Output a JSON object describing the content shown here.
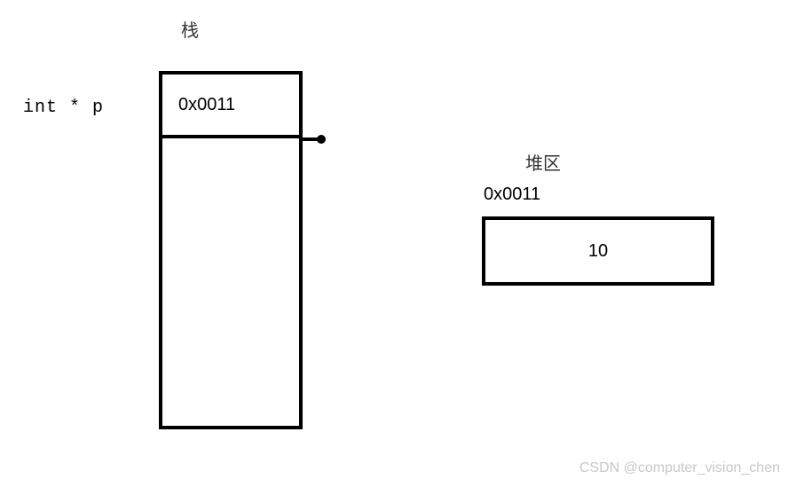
{
  "stack": {
    "title": "栈",
    "pointer_label": "int * p",
    "cell_value": "0x0011"
  },
  "heap": {
    "title": "堆区",
    "address": "0x0011",
    "value": "10"
  },
  "watermark": "CSDN @computer_vision_chen"
}
